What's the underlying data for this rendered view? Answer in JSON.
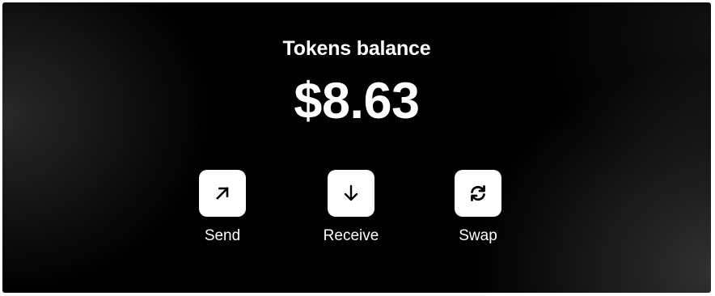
{
  "wallet": {
    "title": "Tokens balance",
    "balance": "$8.63"
  },
  "actions": [
    {
      "label": "Send",
      "icon": "arrow-up-right-icon"
    },
    {
      "label": "Receive",
      "icon": "arrow-down-icon"
    },
    {
      "label": "Swap",
      "icon": "swap-refresh-icon"
    }
  ],
  "colors": {
    "background": "#000000",
    "button": "#ffffff",
    "icon": "#000000",
    "text": "#ffffff"
  }
}
